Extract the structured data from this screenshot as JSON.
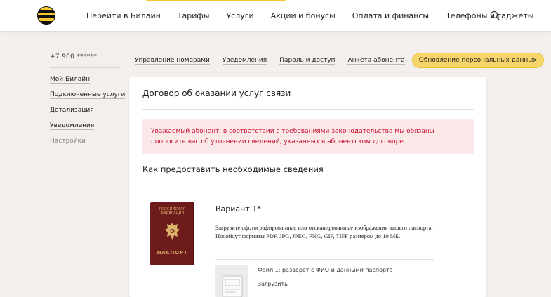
{
  "header": {
    "nav": [
      "Перейти в Билайн",
      "Тарифы",
      "Услуги",
      "Акции и бонусы",
      "Оплата и финансы",
      "Телефоны и гаджеты"
    ],
    "search_icon": "search-icon",
    "brand_color": "#f6c930"
  },
  "sidebar": {
    "phone": "+7 900 ******",
    "items": [
      "Мой Билайн",
      "Подключенные услуги",
      "Детализация",
      "Уведомления",
      "Настройки"
    ]
  },
  "tabs": [
    "Управление номерами",
    "Уведомления",
    "Пароль и доступ",
    "Анкета абонента",
    "Обновление персональных данных"
  ],
  "card": {
    "title": "Договор об оказании услуг связи",
    "alert": "Уважаемый абонент, в соответствии с требованиями законодательства мы обязаны попросить вас об уточнении сведений, указанных в абонентском договоре.",
    "section_title": "Как предоставить необходимые сведения",
    "passport": {
      "top_line1": "РОССИЙСКАЯ",
      "top_line2": "ФЕДЕРАЦИЯ",
      "bottom": "ПАСПОРТ"
    },
    "variant": {
      "title": "Вариант 1*",
      "description": "Загрузите сфотографированные или отсканированные изображения вашего паспорта. Подойдут форматы PDF, JPG, JPEG, PNG, GIF, TIFF размером до 10 МБ.",
      "file_label": "Файл 1: разворот с ФИО и данными паспорта",
      "upload_label": "Загрузить"
    }
  }
}
